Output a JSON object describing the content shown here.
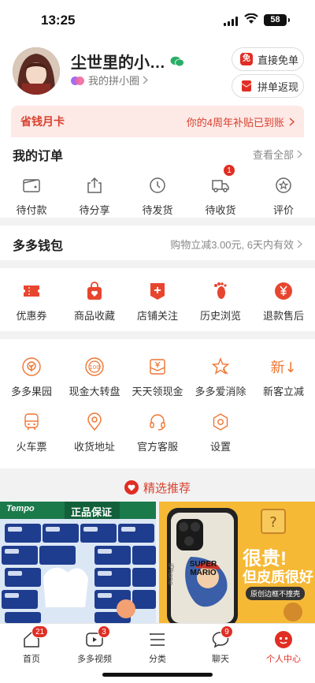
{
  "status": {
    "time": "13:25",
    "battery": "58"
  },
  "profile": {
    "username": "尘世里的小…",
    "circle_label": "我的拼小圈",
    "pill_free": "直接免单",
    "pill_free_icon_text": "免",
    "pill_cashback": "拼单返现"
  },
  "savecard": {
    "title": "省钱月卡",
    "message": "你的4周年补贴已到账"
  },
  "orders": {
    "title": "我的订单",
    "view_all": "查看全部",
    "items": [
      {
        "label": "待付款",
        "icon": "wallet-icon"
      },
      {
        "label": "待分享",
        "icon": "share-icon"
      },
      {
        "label": "待发货",
        "icon": "clock-icon"
      },
      {
        "label": "待收货",
        "icon": "truck-icon",
        "badge": "1"
      },
      {
        "label": "评价",
        "icon": "review-icon"
      }
    ]
  },
  "wallet": {
    "title": "多多钱包",
    "note": "购物立减3.00元, 6天内有效"
  },
  "services": [
    {
      "label": "优惠券",
      "icon": "coupon-icon"
    },
    {
      "label": "商品收藏",
      "icon": "favorite-bag-icon"
    },
    {
      "label": "店铺关注",
      "icon": "store-follow-icon"
    },
    {
      "label": "历史浏览",
      "icon": "footprint-icon"
    },
    {
      "label": "退款售后",
      "icon": "refund-icon"
    }
  ],
  "tools": [
    {
      "label": "多多果园",
      "icon": "tree-icon"
    },
    {
      "label": "现金大转盘",
      "icon": "wheel-icon"
    },
    {
      "label": "天天领现金",
      "icon": "cash-icon"
    },
    {
      "label": "多多爱消除",
      "icon": "star-icon"
    },
    {
      "label": "新客立减",
      "icon": "new-icon",
      "icon_text": "新↓"
    },
    {
      "label": "火车票",
      "icon": "train-icon"
    },
    {
      "label": "收货地址",
      "icon": "location-icon"
    },
    {
      "label": "官方客服",
      "icon": "headset-icon"
    },
    {
      "label": "设置",
      "icon": "settings-icon"
    }
  ],
  "recommend": {
    "title": "精选推荐"
  },
  "products": [
    {
      "brand": "Tempo",
      "tag": "正品保证"
    },
    {
      "headline": "很贵!",
      "subline": "但皮质很好",
      "chip": "原创边框不撞壳",
      "case_brand": "iPhone",
      "case_text": "SUPER MARIO"
    }
  ],
  "tabbar": [
    {
      "label": "首页",
      "icon": "home-icon",
      "badge": "21"
    },
    {
      "label": "多多视频",
      "icon": "video-icon",
      "badge": "3"
    },
    {
      "label": "分类",
      "icon": "category-icon"
    },
    {
      "label": "聊天",
      "icon": "chat-icon",
      "badge": "9"
    },
    {
      "label": "个人中心",
      "icon": "profile-icon",
      "active": true
    }
  ],
  "colors": {
    "accent": "#e02e24",
    "orange": "#f07430",
    "savecard_bg": "#fde9e6"
  }
}
